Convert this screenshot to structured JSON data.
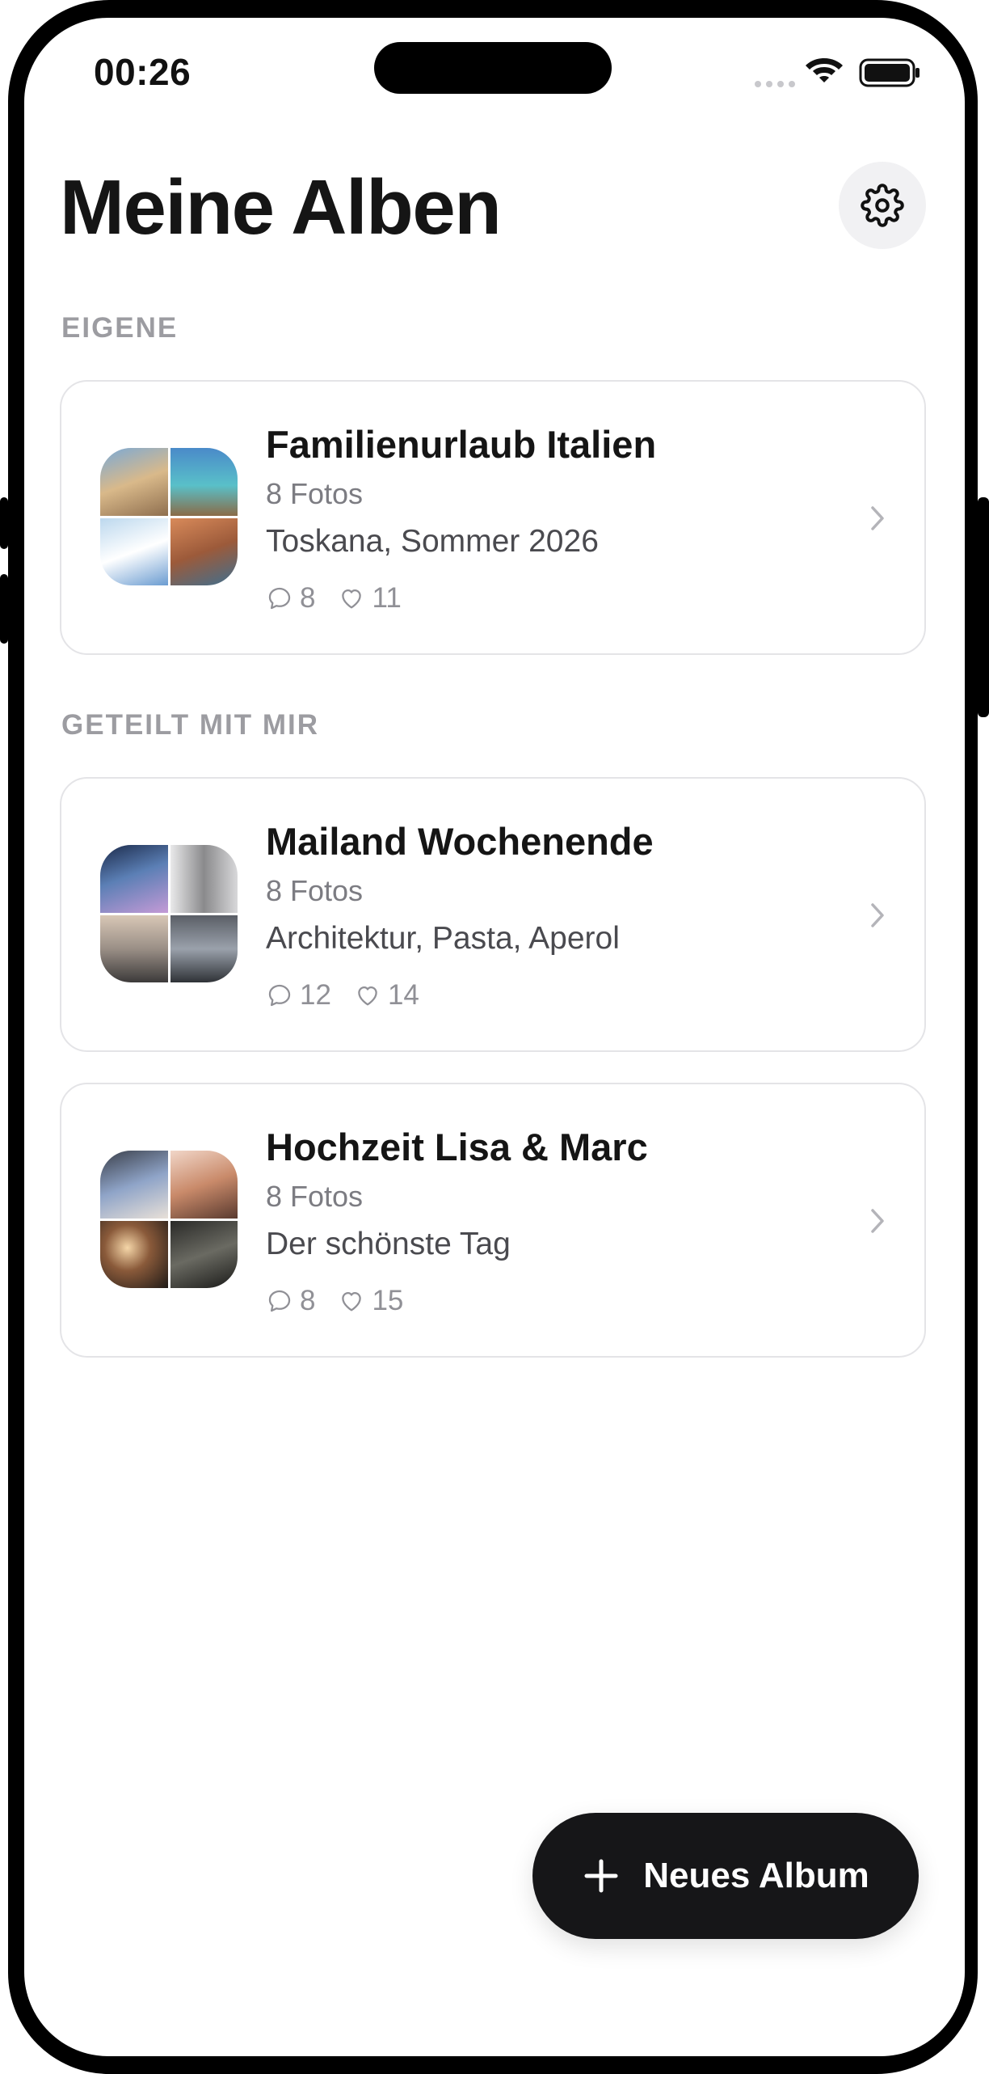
{
  "status_bar": {
    "time": "00:26"
  },
  "header": {
    "title": "Meine Alben"
  },
  "sections": {
    "own_label": "EIGENE",
    "shared_label": "GETEILT MIT MIR"
  },
  "albums": [
    {
      "title": "Familienurlaub Italien",
      "count": "8 Fotos",
      "description": "Toskana, Sommer 2026",
      "comments": "8",
      "likes": "11"
    },
    {
      "title": "Mailand Wochenende",
      "count": "8 Fotos",
      "description": "Architektur, Pasta, Aperol",
      "comments": "12",
      "likes": "14"
    },
    {
      "title": "Hochzeit Lisa & Marc",
      "count": "8 Fotos",
      "description": "Der schönste Tag",
      "comments": "8",
      "likes": "15"
    }
  ],
  "fab": {
    "label": "Neues Album"
  },
  "colors": {
    "text": "#151515",
    "muted": "#7c7c82",
    "section": "#9c9ca1",
    "fab": "#161618"
  },
  "icons": [
    "wifi-icon",
    "battery-icon",
    "gear-icon",
    "comment-icon",
    "heart-icon",
    "chevron-right-icon",
    "plus-icon"
  ]
}
